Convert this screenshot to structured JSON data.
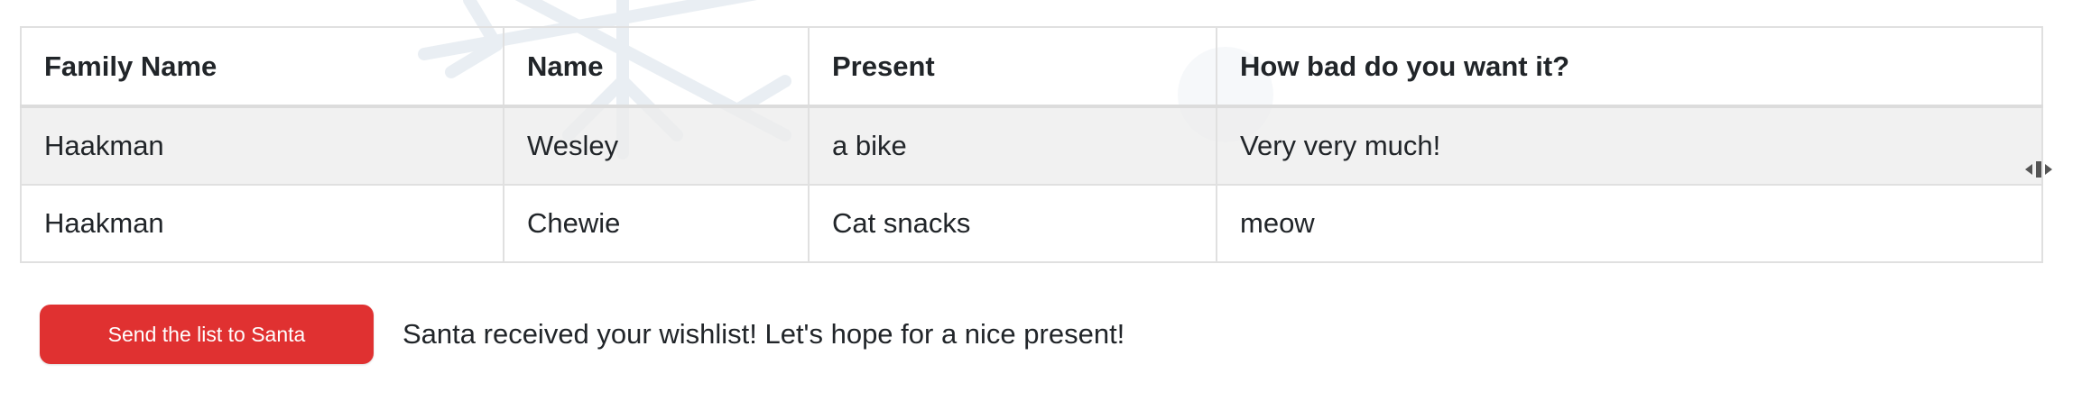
{
  "table": {
    "headers": [
      "Family Name",
      "Name",
      "Present",
      "How bad do you want it?"
    ],
    "rows": [
      [
        "Haakman",
        "Wesley",
        "a bike",
        "Very very much!"
      ],
      [
        "Haakman",
        "Chewie",
        "Cat snacks",
        "meow"
      ]
    ]
  },
  "actions": {
    "send_label": "Send the list to Santa",
    "status": "Santa received your wishlist! Let's hope for a nice present!"
  },
  "colors": {
    "accent": "#e03131",
    "header_border": "#dcdcdc",
    "row_highlight": "#ececec"
  },
  "icons": {
    "background": "snowflake-icon",
    "cursor": "resize-cursor-icon"
  }
}
